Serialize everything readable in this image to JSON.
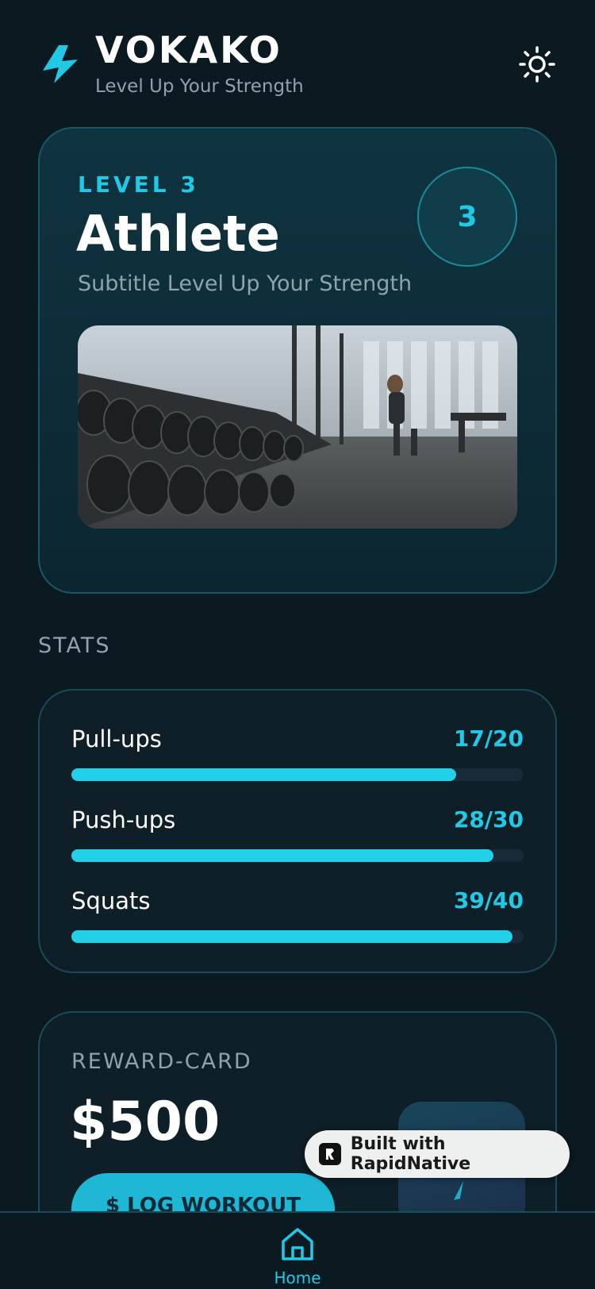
{
  "header": {
    "title": "VOKAKO",
    "subtitle": "Level Up Your Strength"
  },
  "level_card": {
    "label": "LEVEL 3",
    "name": "Athlete",
    "subtitle": "Subtitle Level Up Your Strength",
    "badge": "3"
  },
  "stats": {
    "heading": "STATS",
    "items": [
      {
        "label": "Pull-ups",
        "value": "17/20",
        "progress": 0.85
      },
      {
        "label": "Push-ups",
        "value": "28/30",
        "progress": 0.9333
      },
      {
        "label": "Squats",
        "value": "39/40",
        "progress": 0.975
      }
    ]
  },
  "reward": {
    "label": "REWARD-CARD",
    "amount": "$500",
    "button_label": "$ LOG WORKOUT"
  },
  "badge": {
    "text": "Built with RapidNative"
  },
  "tabbar": {
    "items": [
      {
        "label": "Home",
        "icon": "home-icon",
        "active": true
      }
    ]
  },
  "colors": {
    "accent": "#22c9e6",
    "background": "#0b1a21",
    "card_border": "#1b5866",
    "muted_text": "#8fa3ad"
  }
}
